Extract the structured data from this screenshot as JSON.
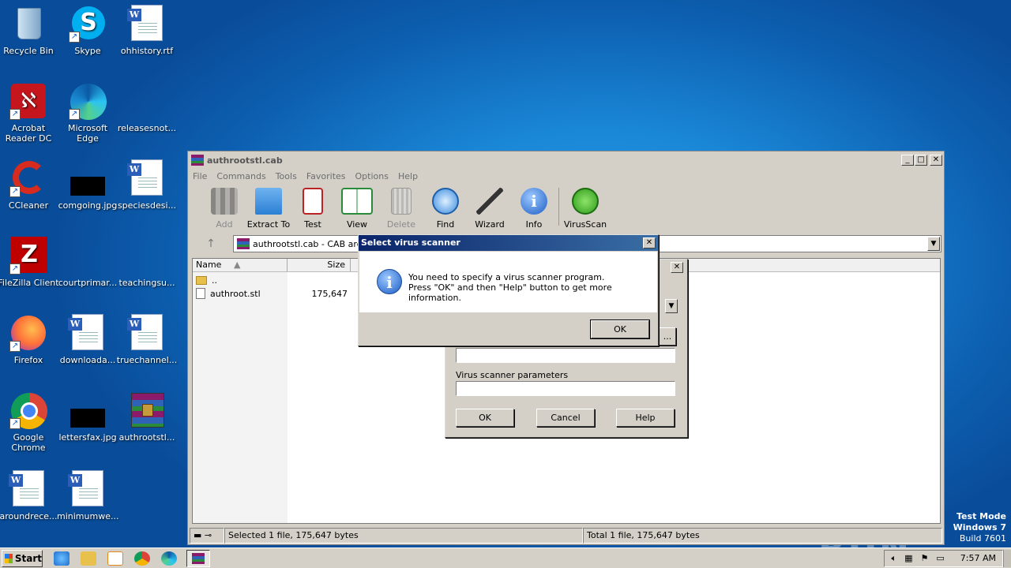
{
  "desktop": {
    "icons": [
      {
        "label": "Recycle Bin"
      },
      {
        "label": "Skype"
      },
      {
        "label": "ohhistory.rtf"
      },
      {
        "label": "Acrobat Reader DC"
      },
      {
        "label": "Microsoft Edge"
      },
      {
        "label": "releasesnot..."
      },
      {
        "label": "CCleaner"
      },
      {
        "label": "comgoing.jpg"
      },
      {
        "label": "speciesdesi..."
      },
      {
        "label": "FileZilla Client"
      },
      {
        "label": "courtprimar..."
      },
      {
        "label": "teachingsu..."
      },
      {
        "label": "Firefox"
      },
      {
        "label": "downloada..."
      },
      {
        "label": "truechannel..."
      },
      {
        "label": "Google Chrome"
      },
      {
        "label": "lettersfax.jpg"
      },
      {
        "label": "authrootstl..."
      },
      {
        "label": "aroundrece..."
      },
      {
        "label": "minimumwe..."
      }
    ],
    "watermark": {
      "brand": "ANY RUN",
      "line1": "Test Mode",
      "line2": "Windows 7",
      "line3": "Build 7601"
    }
  },
  "window": {
    "title": "authrootstl.cab",
    "menu": [
      "File",
      "Commands",
      "Tools",
      "Favorites",
      "Options",
      "Help"
    ],
    "toolbar": [
      {
        "label": "Add",
        "icon": "add-archive-icon"
      },
      {
        "label": "Extract To",
        "icon": "extract-folder-icon"
      },
      {
        "label": "Test",
        "icon": "test-clipboard-icon"
      },
      {
        "label": "View",
        "icon": "view-book-icon"
      },
      {
        "label": "Delete",
        "icon": "delete-trash-icon"
      },
      {
        "label": "Find",
        "icon": "find-magnifier-icon"
      },
      {
        "label": "Wizard",
        "icon": "wizard-wand-icon"
      },
      {
        "label": "Info",
        "icon": "info-icon"
      },
      {
        "label": "VirusScan",
        "icon": "virusscan-bug-icon"
      }
    ],
    "address": "authrootstl.cab - CAB archive, unpacked size 175,647 bytes",
    "columns": {
      "name": "Name",
      "size": "Size"
    },
    "files": [
      {
        "name": "..",
        "size": ""
      },
      {
        "name": "authroot.stl",
        "size": "175,647"
      }
    ],
    "status_left": "Selected 1 file, 175,647 bytes",
    "status_right": "Total 1 file, 175,647 bytes"
  },
  "scanner_dialog": {
    "params_label": "Virus scanner parameters",
    "ok": "OK",
    "cancel": "Cancel",
    "help": "Help",
    "browse": "..."
  },
  "message_box": {
    "title": "Select virus scanner",
    "line1": "You need to specify a virus scanner program.",
    "line2": "Press \"OK\" and then \"Help\" button to get more information.",
    "ok": "OK"
  },
  "taskbar": {
    "start": "Start",
    "clock": "7:57 AM"
  },
  "colors": {
    "desktop": "#1a86d6",
    "title_active": "#0a246a",
    "face": "#d4d0c8"
  }
}
